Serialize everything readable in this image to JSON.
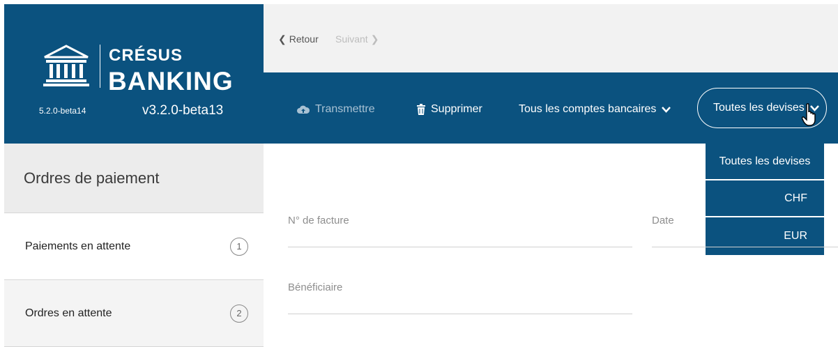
{
  "logo": {
    "brand_top": "CRÉSUS",
    "brand_bottom": "BANKING",
    "version_small": "5.2.0-beta14",
    "version_large": "v3.2.0-beta13"
  },
  "nav": {
    "back_label": "Retour",
    "next_label": "Suivant"
  },
  "toolbar": {
    "transmit_label": "Transmettre",
    "delete_label": "Supprimer",
    "accounts_label": "Tous les comptes bancaires",
    "currency_label": "Toutes les devises"
  },
  "currency_dropdown": {
    "options": [
      "Toutes les devises",
      "CHF",
      "EUR"
    ]
  },
  "sidebar": {
    "title": "Ordres de paiement",
    "items": [
      {
        "label": "Paiements en attente",
        "count": "1"
      },
      {
        "label": "Ordres en attente",
        "count": "2"
      }
    ]
  },
  "form": {
    "invoice_label": "N° de facture",
    "date_label": "Date",
    "beneficiary_label": "Bénéficiaire"
  },
  "colors": {
    "brand_blue": "#0b527f",
    "nav_gray": "#f2f2f2"
  }
}
